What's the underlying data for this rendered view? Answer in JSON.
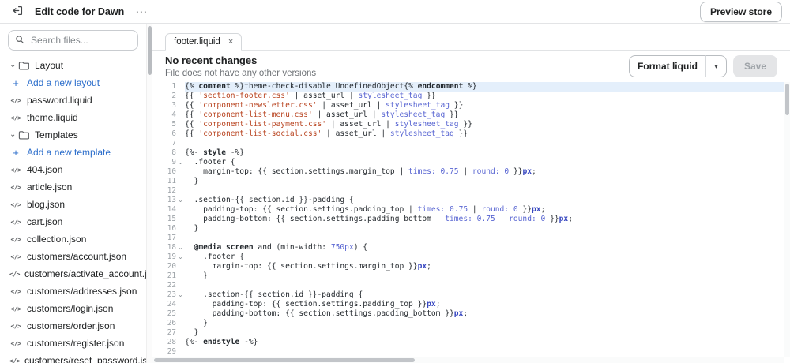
{
  "topbar": {
    "title": "Edit code for Dawn",
    "overflow_menu": "⋯",
    "preview_button": "Preview store"
  },
  "sidebar": {
    "search_placeholder": "Search files...",
    "tree": [
      {
        "type": "folder",
        "label": "Layout"
      },
      {
        "type": "add",
        "label": "Add a new layout"
      },
      {
        "type": "file",
        "label": "password.liquid"
      },
      {
        "type": "file",
        "label": "theme.liquid"
      },
      {
        "type": "folder",
        "label": "Templates"
      },
      {
        "type": "add",
        "label": "Add a new template"
      },
      {
        "type": "file",
        "label": "404.json"
      },
      {
        "type": "file",
        "label": "article.json"
      },
      {
        "type": "file",
        "label": "blog.json"
      },
      {
        "type": "file",
        "label": "cart.json"
      },
      {
        "type": "file",
        "label": "collection.json"
      },
      {
        "type": "file",
        "label": "customers/account.json"
      },
      {
        "type": "file",
        "label": "customers/activate_account.json"
      },
      {
        "type": "file",
        "label": "customers/addresses.json"
      },
      {
        "type": "file",
        "label": "customers/login.json"
      },
      {
        "type": "file",
        "label": "customers/order.json"
      },
      {
        "type": "file",
        "label": "customers/register.json"
      },
      {
        "type": "file",
        "label": "customers/reset_password.json"
      }
    ]
  },
  "editor": {
    "tab": {
      "label": "footer.liquid",
      "close_glyph": "×"
    },
    "status": {
      "title": "No recent changes",
      "subtitle": "File does not have any other versions"
    },
    "actions": {
      "format": "Format liquid",
      "caret_glyph": "▾",
      "save": "Save"
    },
    "code": {
      "lines": [
        {
          "n": 1,
          "hl": true,
          "t": [
            [
              "p",
              "{% "
            ],
            [
              "k",
              "comment"
            ],
            [
              "p",
              " %}theme-check-disable UndefinedObject{% "
            ],
            [
              "k",
              "endcomment"
            ],
            [
              "p",
              " %}"
            ]
          ]
        },
        {
          "n": 2,
          "t": [
            [
              "p",
              "{{ "
            ],
            [
              "s",
              "'section-footer.css'"
            ],
            [
              "p",
              " | asset_url | "
            ],
            [
              "b",
              "stylesheet_tag"
            ],
            [
              "p",
              " }}"
            ]
          ]
        },
        {
          "n": 3,
          "t": [
            [
              "p",
              "{{ "
            ],
            [
              "s",
              "'component-newsletter.css'"
            ],
            [
              "p",
              " | asset_url | "
            ],
            [
              "b",
              "stylesheet_tag"
            ],
            [
              "p",
              " }}"
            ]
          ]
        },
        {
          "n": 4,
          "t": [
            [
              "p",
              "{{ "
            ],
            [
              "s",
              "'component-list-menu.css'"
            ],
            [
              "p",
              " | asset_url | "
            ],
            [
              "b",
              "stylesheet_tag"
            ],
            [
              "p",
              " }}"
            ]
          ]
        },
        {
          "n": 5,
          "t": [
            [
              "p",
              "{{ "
            ],
            [
              "s",
              "'component-list-payment.css'"
            ],
            [
              "p",
              " | asset_url | "
            ],
            [
              "b",
              "stylesheet_tag"
            ],
            [
              "p",
              " }}"
            ]
          ]
        },
        {
          "n": 6,
          "t": [
            [
              "p",
              "{{ "
            ],
            [
              "s",
              "'component-list-social.css'"
            ],
            [
              "p",
              " | asset_url | "
            ],
            [
              "b",
              "stylesheet_tag"
            ],
            [
              "p",
              " }}"
            ]
          ]
        },
        {
          "n": 7,
          "t": []
        },
        {
          "n": 8,
          "t": [
            [
              "p",
              "{%- "
            ],
            [
              "k",
              "style"
            ],
            [
              "p",
              " -%}"
            ]
          ]
        },
        {
          "n": 9,
          "fold": true,
          "t": [
            [
              "p",
              "  .footer {"
            ]
          ]
        },
        {
          "n": 10,
          "t": [
            [
              "p",
              "    margin-top: {{ section.settings.margin_top | "
            ],
            [
              "b",
              "times:"
            ],
            [
              "p",
              " "
            ],
            [
              "b",
              "0.75"
            ],
            [
              "p",
              " | "
            ],
            [
              "b",
              "round:"
            ],
            [
              "p",
              " "
            ],
            [
              "b",
              "0"
            ],
            [
              "p",
              " }}"
            ],
            [
              "bb",
              "px"
            ],
            [
              "p",
              ";"
            ]
          ]
        },
        {
          "n": 11,
          "t": [
            [
              "p",
              "  }"
            ]
          ]
        },
        {
          "n": 12,
          "t": []
        },
        {
          "n": 13,
          "fold": true,
          "t": [
            [
              "p",
              "  .section-{{ section.id }}-padding {"
            ]
          ]
        },
        {
          "n": 14,
          "t": [
            [
              "p",
              "    padding-top: {{ section.settings.padding_top | "
            ],
            [
              "b",
              "times:"
            ],
            [
              "p",
              " "
            ],
            [
              "b",
              "0.75"
            ],
            [
              "p",
              " | "
            ],
            [
              "b",
              "round:"
            ],
            [
              "p",
              " "
            ],
            [
              "b",
              "0"
            ],
            [
              "p",
              " }}"
            ],
            [
              "bb",
              "px"
            ],
            [
              "p",
              ";"
            ]
          ]
        },
        {
          "n": 15,
          "t": [
            [
              "p",
              "    padding-bottom: {{ section.settings.padding_bottom | "
            ],
            [
              "b",
              "times:"
            ],
            [
              "p",
              " "
            ],
            [
              "b",
              "0.75"
            ],
            [
              "p",
              " | "
            ],
            [
              "b",
              "round:"
            ],
            [
              "p",
              " "
            ],
            [
              "b",
              "0"
            ],
            [
              "p",
              " }}"
            ],
            [
              "bb",
              "px"
            ],
            [
              "p",
              ";"
            ]
          ]
        },
        {
          "n": 16,
          "t": [
            [
              "p",
              "  }"
            ]
          ]
        },
        {
          "n": 17,
          "t": []
        },
        {
          "n": 18,
          "fold": true,
          "t": [
            [
              "p",
              "  "
            ],
            [
              "k",
              "@media screen"
            ],
            [
              "p",
              " and (min-width: "
            ],
            [
              "b",
              "750px"
            ],
            [
              "p",
              ") {"
            ]
          ]
        },
        {
          "n": 19,
          "fold": true,
          "t": [
            [
              "p",
              "    .footer {"
            ]
          ]
        },
        {
          "n": 20,
          "t": [
            [
              "p",
              "      margin-top: {{ section.settings.margin_top }}"
            ],
            [
              "bb",
              "px"
            ],
            [
              "p",
              ";"
            ]
          ]
        },
        {
          "n": 21,
          "t": [
            [
              "p",
              "    }"
            ]
          ]
        },
        {
          "n": 22,
          "t": []
        },
        {
          "n": 23,
          "fold": true,
          "t": [
            [
              "p",
              "    .section-{{ section.id }}-padding {"
            ]
          ]
        },
        {
          "n": 24,
          "t": [
            [
              "p",
              "      padding-top: {{ section.settings.padding_top }}"
            ],
            [
              "bb",
              "px"
            ],
            [
              "p",
              ";"
            ]
          ]
        },
        {
          "n": 25,
          "t": [
            [
              "p",
              "      padding-bottom: {{ section.settings.padding_bottom }}"
            ],
            [
              "bb",
              "px"
            ],
            [
              "p",
              ";"
            ]
          ]
        },
        {
          "n": 26,
          "t": [
            [
              "p",
              "    }"
            ]
          ]
        },
        {
          "n": 27,
          "t": [
            [
              "p",
              "  }"
            ]
          ]
        },
        {
          "n": 28,
          "t": [
            [
              "p",
              "{%- "
            ],
            [
              "k",
              "endstyle"
            ],
            [
              "p",
              " -%}"
            ]
          ]
        },
        {
          "n": 29,
          "t": []
        }
      ]
    }
  },
  "colors": {
    "accent_blue": "#2c6ecb",
    "highlight_line": "#e4effb",
    "code_string": "#b8431f",
    "code_filter": "#5865d2"
  }
}
